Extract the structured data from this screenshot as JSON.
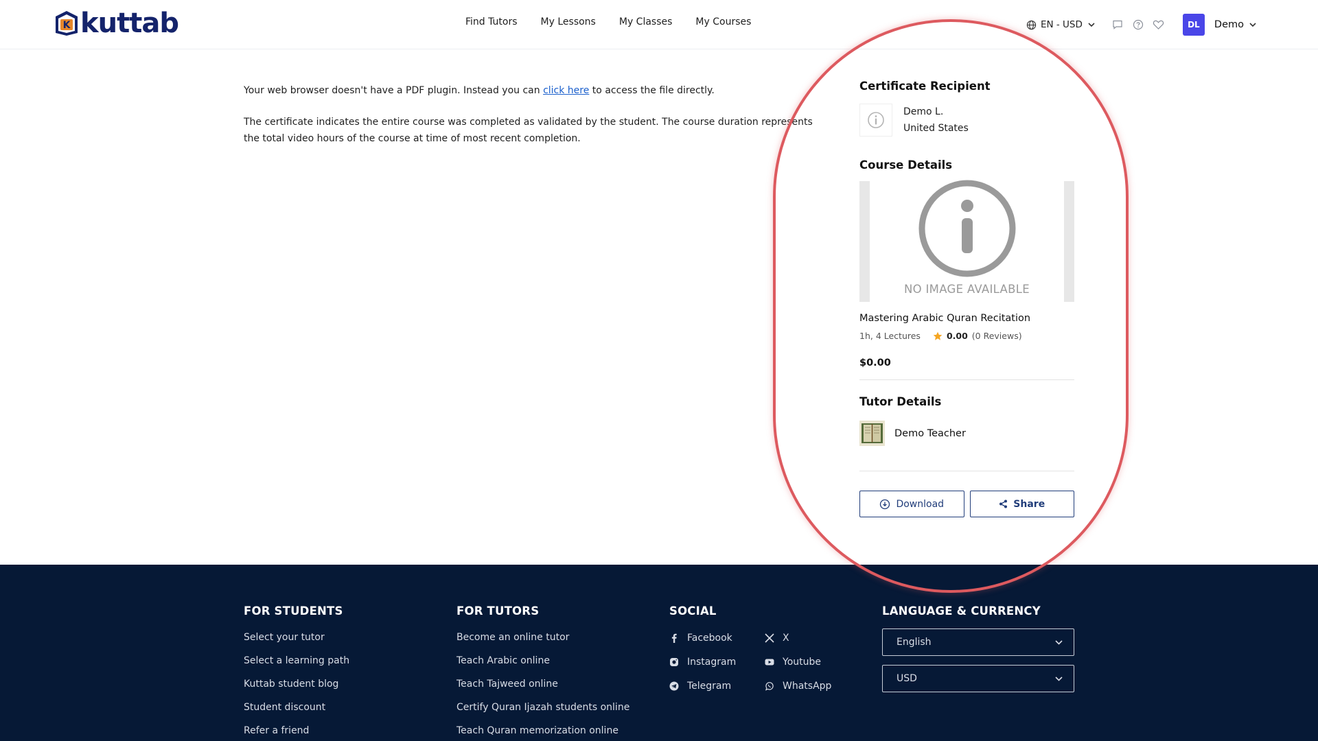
{
  "header": {
    "logo_text": "kuttab",
    "nav": [
      "Find Tutors",
      "My Lessons",
      "My Classes",
      "My Courses"
    ],
    "lang_currency": "EN - USD",
    "avatar_initials": "DL",
    "user_name": "Demo"
  },
  "main": {
    "notice_before_link": "Your web browser doesn't have a PDF plugin. Instead you can ",
    "notice_link": "click here",
    "notice_after_link": " to access the file directly.",
    "description": "The certificate indicates the entire course was completed as validated by the student. The course duration represents the total video hours of the course at time of most recent completion."
  },
  "sidebar": {
    "recipient_title": "Certificate Recipient",
    "recipient_name": "Demo L.",
    "recipient_country": "United States",
    "course_title": "Course Details",
    "no_image_text": "NO IMAGE AVAILABLE",
    "course_name": "Mastering Arabic Quran Recitation",
    "course_meta": "1h, 4 Lectures",
    "rating": "0.00",
    "reviews": "(0 Reviews)",
    "price": "$0.00",
    "tutor_title": "Tutor Details",
    "tutor_name": "Demo Teacher",
    "download_label": "Download",
    "share_label": "Share"
  },
  "footer": {
    "students": {
      "title": "FOR STUDENTS",
      "items": [
        "Select your tutor",
        "Select a learning path",
        "Kuttab student blog",
        "Student discount",
        "Refer a friend"
      ]
    },
    "tutors": {
      "title": "FOR TUTORS",
      "items": [
        "Become an online tutor",
        "Teach Arabic online",
        "Teach Tajweed online",
        "Certify Quran Ijazah students online",
        "Teach Quran memorization online"
      ]
    },
    "social": {
      "title": "SOCIAL",
      "items": [
        "Facebook",
        "X",
        "Instagram",
        "Youtube",
        "Telegram",
        "WhatsApp"
      ],
      "icons": [
        "facebook-icon",
        "x-icon",
        "instagram-icon",
        "youtube-icon",
        "telegram-icon",
        "whatsapp-icon"
      ]
    },
    "lang": {
      "title": "LANGUAGE & CURRENCY",
      "language": "English",
      "currency": "USD"
    }
  },
  "colors": {
    "brand_navy": "#14236b",
    "avatar_bg": "#4a46e8",
    "button_border": "#213d7a",
    "footer_bg": "#061936",
    "annotation": "#dd5a5f",
    "star": "#f5a623"
  }
}
